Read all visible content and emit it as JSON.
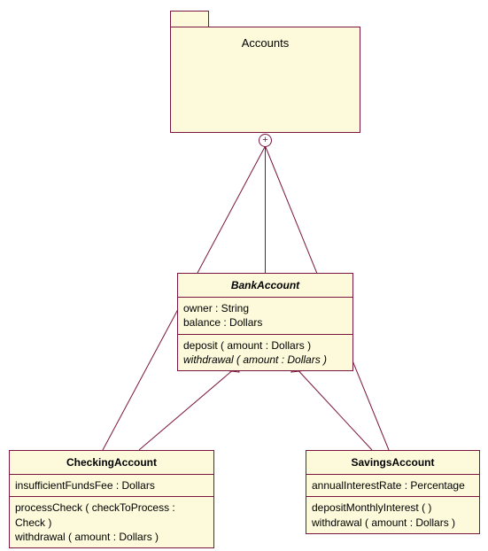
{
  "package": {
    "name": "Accounts"
  },
  "anchor_symbol": "+",
  "classes": {
    "bankAccount": {
      "name": "BankAccount",
      "attributes": [
        "owner : String",
        "balance : Dollars"
      ],
      "operations": [
        "deposit ( amount : Dollars )",
        "withdrawal ( amount : Dollars )"
      ],
      "abstract": true,
      "abstract_operations": [
        false,
        true
      ]
    },
    "checkingAccount": {
      "name": "CheckingAccount",
      "attributes": [
        "insufficientFundsFee : Dollars"
      ],
      "operations": [
        "processCheck ( checkToProcess : Check )",
        "withdrawal ( amount : Dollars )"
      ]
    },
    "savingsAccount": {
      "name": "SavingsAccount",
      "attributes": [
        "annualInterestRate : Percentage"
      ],
      "operations": [
        "depositMonthlyInterest (  )",
        "withdrawal ( amount : Dollars )"
      ]
    }
  },
  "colors": {
    "fill": "#fcfada",
    "stroke": "#7a153f"
  }
}
